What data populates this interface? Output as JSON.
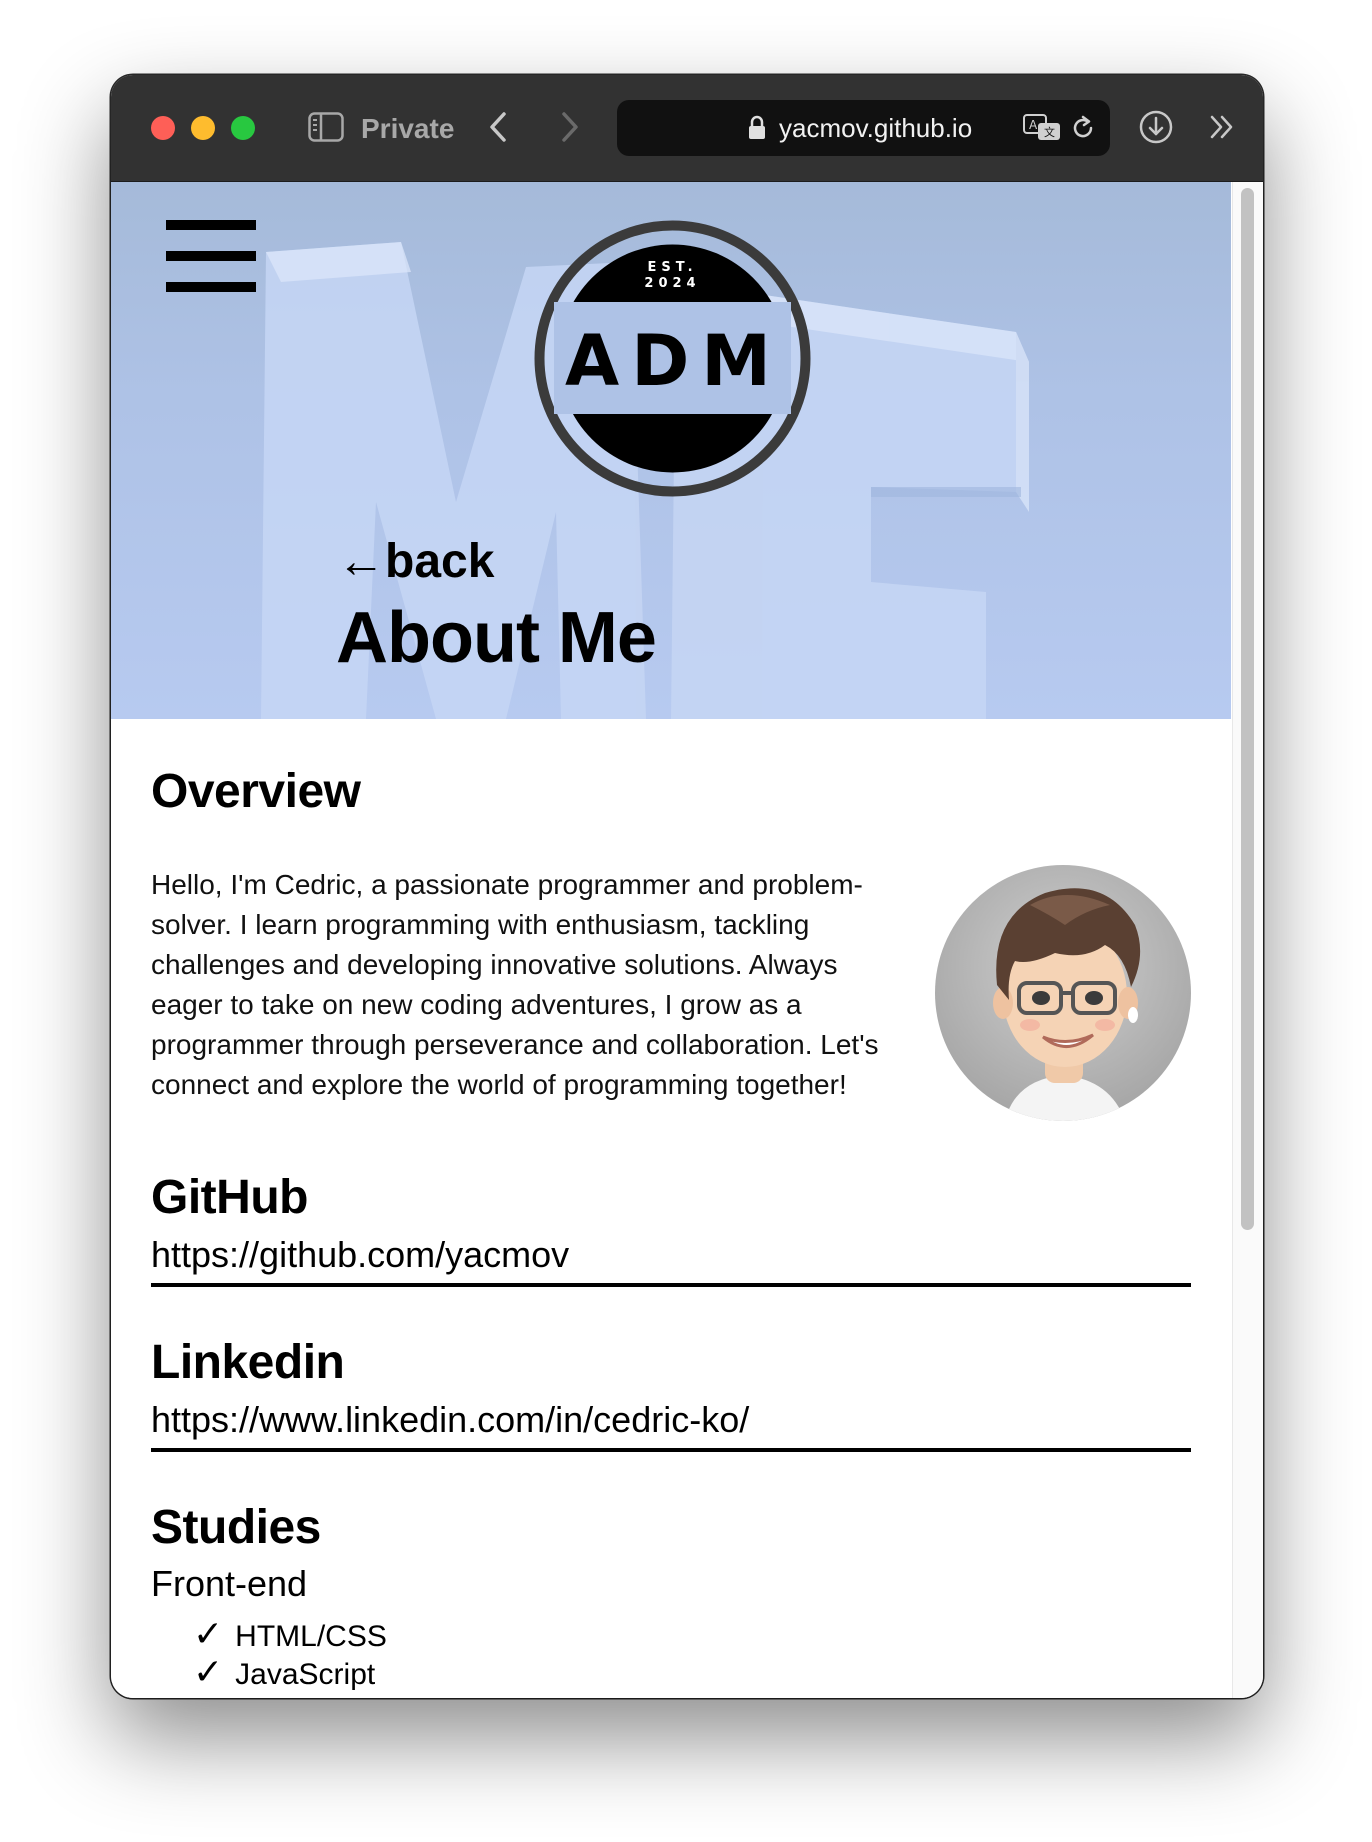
{
  "browser": {
    "private_label": "Private",
    "url": "yacmov.github.io"
  },
  "hero": {
    "logo": {
      "top_text": "EST.",
      "year": "2024",
      "letters": "ADM"
    },
    "back_label": "←back",
    "title": "About Me",
    "background_text": "ME"
  },
  "overview": {
    "heading": "Overview",
    "text": "Hello, I'm Cedric, a passionate programmer and problem-solver. I learn programming with enthusiasm, tackling challenges and developing innovative solutions. Always eager to take on new coding adventures, I grow as a programmer through perseverance and collaboration. Let's connect and explore the world of programming together!"
  },
  "github": {
    "heading": "GitHub",
    "url": "https://github.com/yacmov"
  },
  "linkedin": {
    "heading": "Linkedin",
    "url": "https://www.linkedin.com/in/cedric-ko/"
  },
  "studies": {
    "heading": "Studies",
    "category": "Front-end",
    "check": "✓",
    "items": [
      "HTML/CSS",
      "JavaScript"
    ]
  },
  "colors": {
    "titlebar": "#323232",
    "hero_bg": "#aec2e6",
    "text": "#000000"
  },
  "icons": [
    "sidebar-icon",
    "chevron-left-icon",
    "chevron-right-icon",
    "lock-icon",
    "translate-icon",
    "reload-icon",
    "download-icon",
    "chevron-double-right-icon",
    "menu-icon"
  ]
}
